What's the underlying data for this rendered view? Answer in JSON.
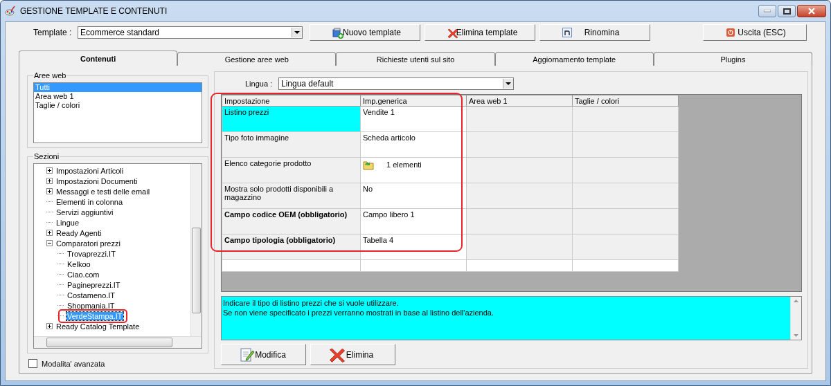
{
  "window": {
    "title": "GESTIONE TEMPLATE E CONTENUTI"
  },
  "toolbar": {
    "template_label": "Template :",
    "template_value": "Ecommerce standard",
    "buttons": [
      {
        "kind": "new",
        "label": "Nuovo template"
      },
      {
        "kind": "delete",
        "label": "Elimina template"
      },
      {
        "kind": "rename",
        "label": "Rinomina"
      },
      {
        "kind": "exit",
        "label": "Uscita (ESC)"
      }
    ]
  },
  "tabs": [
    {
      "label": "Contenuti",
      "selected": true
    },
    {
      "label": "Gestione aree web",
      "selected": false
    },
    {
      "label": "Richieste utenti sul sito",
      "selected": false
    },
    {
      "label": "Aggiornamento template",
      "selected": false
    },
    {
      "label": "Plugins",
      "selected": false
    }
  ],
  "web_areas": {
    "title": "Aree web",
    "items": [
      {
        "label": "Tutti",
        "selected": true
      },
      {
        "label": "Area web 1",
        "selected": false
      },
      {
        "label": "Taglie / colori",
        "selected": false
      }
    ]
  },
  "sections": {
    "title": "Sezioni",
    "items": [
      {
        "label": "Impostazioni Articoli",
        "expanded": false,
        "selected": false
      },
      {
        "label": "Impostazioni Documenti",
        "expanded": false,
        "selected": false
      },
      {
        "label": "Messaggi e testi delle email",
        "expanded": false,
        "selected": false
      },
      {
        "label": "Elementi in colonna",
        "selected": false
      },
      {
        "label": "Servizi aggiuntivi",
        "selected": false
      },
      {
        "label": "Lingue",
        "selected": false
      },
      {
        "label": "Ready Agenti",
        "expanded": false,
        "selected": false
      },
      {
        "label": "Comparatori prezzi",
        "expanded": true,
        "selected": false,
        "children": [
          {
            "label": "Trovaprezzi.IT",
            "selected": false
          },
          {
            "label": "Kelkoo",
            "selected": false
          },
          {
            "label": "Ciao.com",
            "selected": false
          },
          {
            "label": "Pagineprezzi.IT",
            "selected": false
          },
          {
            "label": "Costameno.IT",
            "selected": false
          },
          {
            "label": "Shopmania.IT",
            "selected": false
          },
          {
            "label": "VerdeStampa.IT",
            "selected": true
          }
        ]
      },
      {
        "label": "Ready Catalog Template",
        "expanded": false,
        "selected": false
      }
    ]
  },
  "advanced_mode": {
    "label": "Modalita' avanzata",
    "checked": false
  },
  "language": {
    "label": "Lingua :",
    "value": "Lingua default"
  },
  "table": {
    "columns": [
      "Impostazione",
      "Imp.generica",
      "Area web 1",
      "Taglie / colori"
    ],
    "rows": [
      {
        "setting": "Listino prezzi",
        "generic": "Vendite 1",
        "selected": true,
        "required": false
      },
      {
        "setting": "Tipo foto immagine",
        "generic": "Scheda articolo",
        "selected": false,
        "required": false
      },
      {
        "setting": "Elenco categorie prodotto",
        "generic": "1 elementi",
        "kind": "list",
        "selected": false,
        "required": false
      },
      {
        "setting": "Mostra solo prodotti disponibili a magazzino",
        "generic": "No",
        "selected": false,
        "required": false
      },
      {
        "setting": "Campo codice OEM (obbligatorio)",
        "generic": "Campo libero 1",
        "selected": false,
        "required": true
      },
      {
        "setting": "Campo tipologia (obbligatorio)",
        "generic": "Tabella 4",
        "selected": false,
        "required": true
      }
    ]
  },
  "description": [
    "Indicare il tipo di listino prezzi che si vuole utilizzare.",
    "Se non viene specificato i prezzi verranno mostrati in base al listino dell'azienda."
  ],
  "actions": [
    {
      "kind": "edit",
      "label": "Modifica"
    },
    {
      "kind": "delete",
      "label": "Elimina"
    }
  ]
}
